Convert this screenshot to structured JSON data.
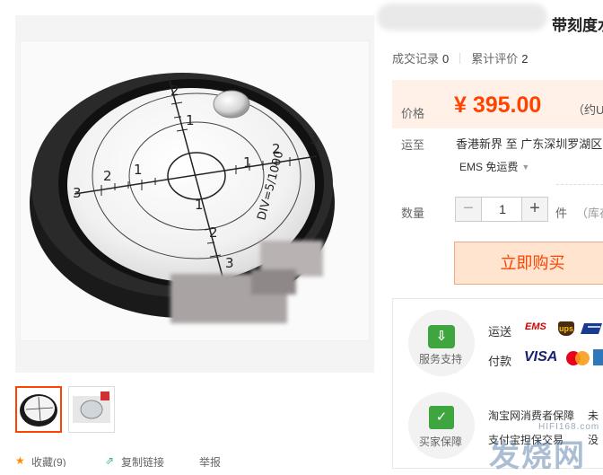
{
  "product": {
    "title_visible": "带刻度水"
  },
  "stats": {
    "sales_label": "成交记录",
    "sales_count": "0",
    "reviews_label": "累计评价",
    "reviews_count": "2"
  },
  "price": {
    "label": "价格",
    "value": "¥ 395.00",
    "approx": "（约U"
  },
  "shipping": {
    "label": "运至",
    "route": "香港新界 至  广东深圳罗湖区",
    "method": "EMS 免运费"
  },
  "quantity": {
    "label": "数量",
    "minus": "−",
    "value": "1",
    "plus": "+",
    "unit": "件",
    "stock": "（库存"
  },
  "buy_button": "立即购买",
  "services": {
    "delivery_label": "服务支持",
    "buyer_label": "买家保障",
    "shipping_row": "运送",
    "payment_row": "付款",
    "carriers": {
      "ems": "EMS",
      "ups": "ups"
    },
    "payments": {
      "visa": "VISA"
    },
    "guarantee_line1": "淘宝网消费者保障",
    "guarantee_line1b": "未",
    "guarantee_line2": "支付宝担保交易",
    "guarantee_line2b": "没"
  },
  "level": {
    "scale_label": "DIV=5/1000",
    "ticks": [
      "1",
      "2",
      "3"
    ]
  },
  "actions": {
    "favorite": "收藏(9)",
    "share": "复制链接",
    "report": "举报"
  },
  "watermark": {
    "sub": "HIFI168.com",
    "main": "发烧网"
  },
  "colors": {
    "accent": "#ff4400",
    "price_bg": "#fff1e8",
    "service_green": "#3fa63f"
  }
}
